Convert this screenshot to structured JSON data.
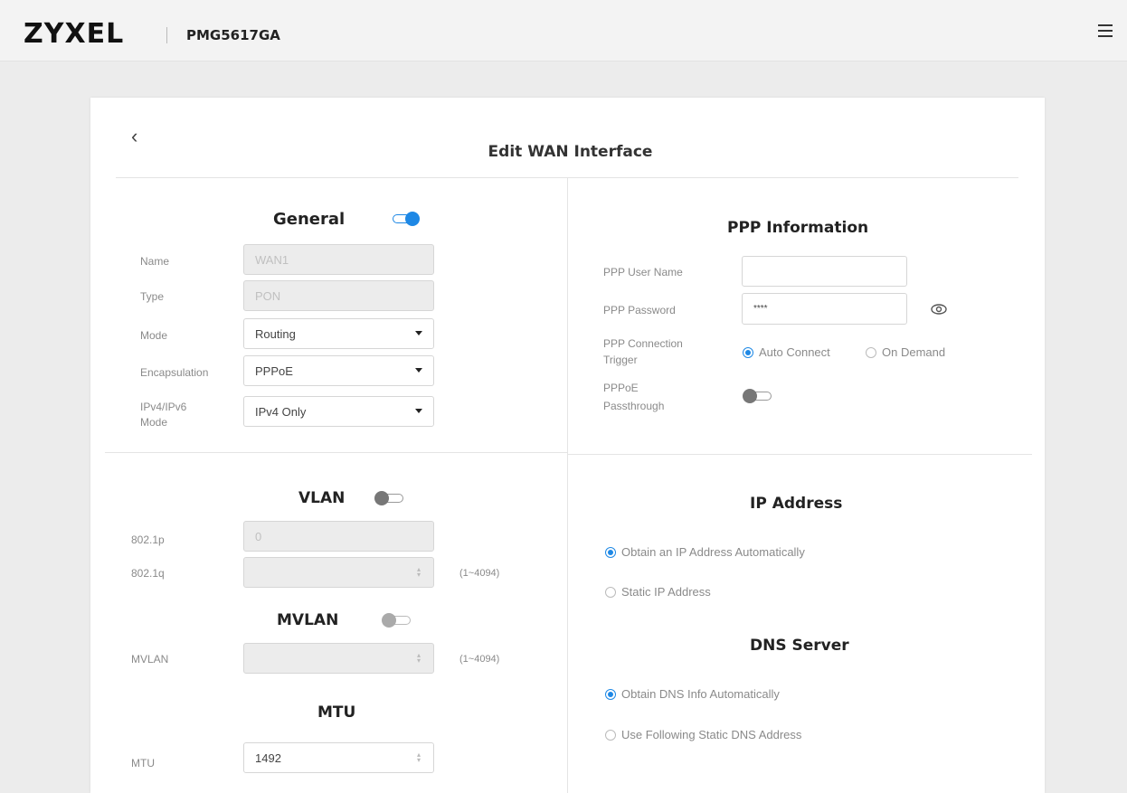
{
  "header": {
    "brand": "ZYXEL",
    "model": "PMG5617GA"
  },
  "page": {
    "title": "Edit WAN Interface",
    "back_glyph": "‹"
  },
  "general": {
    "title": "General",
    "enabled": true,
    "name_label": "Name",
    "name_value": "WAN1",
    "type_label": "Type",
    "type_value": "PON",
    "mode_label": "Mode",
    "mode_value": "Routing",
    "encap_label": "Encapsulation",
    "encap_value": "PPPoE",
    "ipmode_label_1": "IPv4/IPv6",
    "ipmode_label_2": "Mode",
    "ipmode_value": "IPv4 Only"
  },
  "ppp": {
    "title": "PPP Information",
    "user_label": "PPP User Name",
    "user_value": "",
    "password_label": "PPP Password",
    "password_value": "****",
    "trigger_label_1": "PPP Connection",
    "trigger_label_2": "Trigger",
    "trigger_options": [
      "Auto Connect",
      "On Demand"
    ],
    "trigger_selected": "Auto Connect",
    "passthrough_label_1": "PPPoE",
    "passthrough_label_2": "Passthrough",
    "passthrough_enabled": false
  },
  "vlan": {
    "title": "VLAN",
    "enabled": false,
    "p_label": "802.1p",
    "p_value": "0",
    "q_label": "802.1q",
    "q_value": "",
    "q_range": "(1~4094)"
  },
  "mvlan": {
    "title": "MVLAN",
    "enabled": false,
    "label": "MVLAN",
    "value": "",
    "range": "(1~4094)"
  },
  "mtu": {
    "title": "MTU",
    "label": "MTU",
    "value": "1492"
  },
  "ip_address": {
    "title": "IP Address",
    "options": [
      "Obtain an IP Address Automatically",
      "Static IP Address"
    ],
    "selected": "Obtain an IP Address Automatically"
  },
  "dns": {
    "title": "DNS Server",
    "options": [
      "Obtain DNS Info Automatically",
      "Use Following Static DNS Address"
    ],
    "selected": "Obtain DNS Info Automatically"
  },
  "colors": {
    "accent": "#1e88e5"
  }
}
